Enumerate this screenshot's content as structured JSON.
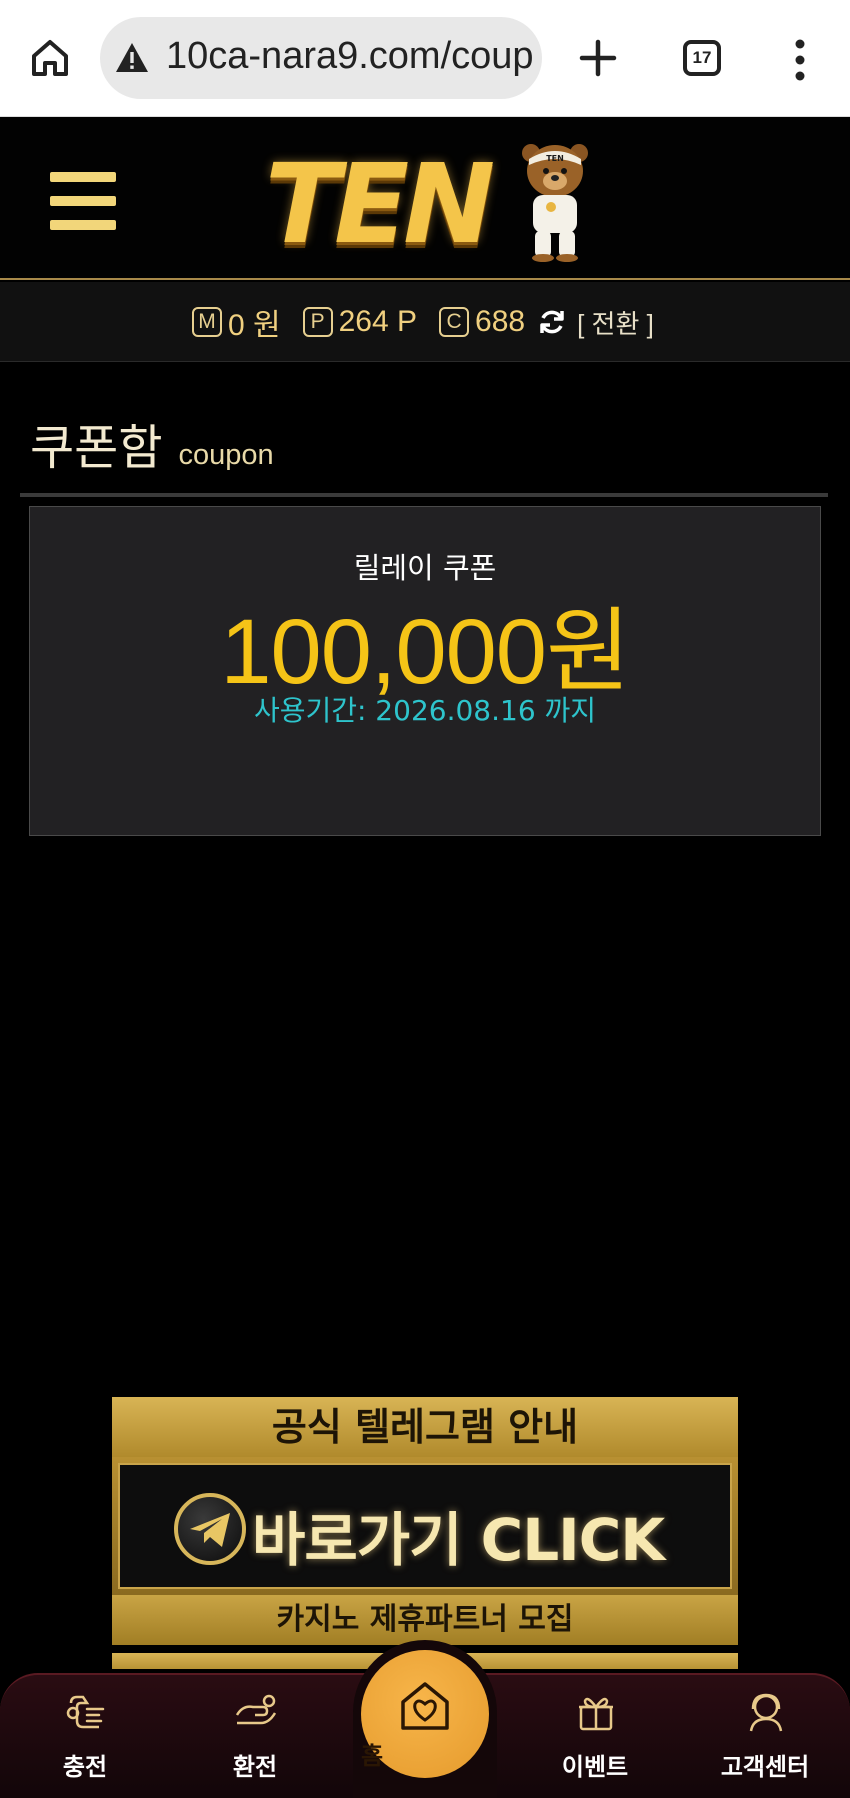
{
  "browser": {
    "url": "10ca-nara9.com/coup",
    "tab_count": "17"
  },
  "header": {
    "logo_text": "TEN",
    "bear_cap_text": "TEN"
  },
  "balance": {
    "money_icon": "M",
    "money_value": "0 원",
    "point_icon": "P",
    "point_value": "264 P",
    "coin_icon": "C",
    "coin_value": "688",
    "convert_label": "[ 전환 ]"
  },
  "page": {
    "title": "쿠폰함",
    "subtitle": "coupon"
  },
  "coupon": {
    "name": "릴레이 쿠폰",
    "amount": "100,000원",
    "expiry": "사용기간: 2026.08.16 까지"
  },
  "banner": {
    "top_text": "공식 텔레그램 안내",
    "click_text": "바로가기 CLICK",
    "bottom_text": "카지노 제휴파트너 모집"
  },
  "nav": {
    "deposit": "충전",
    "withdraw": "환전",
    "home": "홈",
    "event": "이벤트",
    "support": "고객센터"
  },
  "colors": {
    "accent_gold": "#f5c417",
    "expiry_cyan": "#2ec4cc",
    "nav_bg": "#2a0c12",
    "home_orange": "#f0a83a"
  }
}
